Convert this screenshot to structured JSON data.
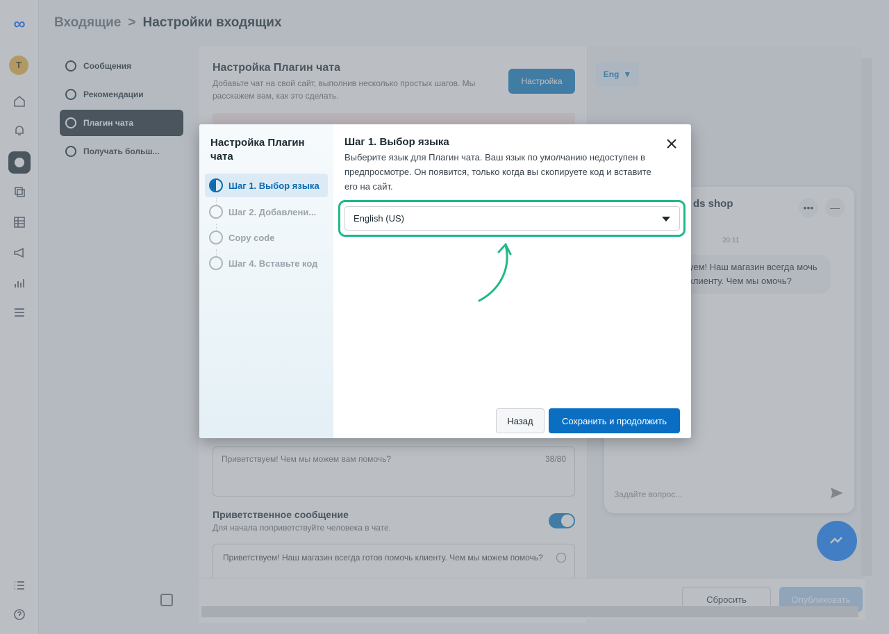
{
  "app": {
    "breadcrumb": {
      "parent": "Входящие",
      "separator": ">",
      "current": "Настройки входящих"
    },
    "avatar_letter": "T",
    "subnav": [
      {
        "label": "Сообщения"
      },
      {
        "label": "Рекомендации"
      },
      {
        "label": "Плагин чата"
      },
      {
        "label": "Получать больш..."
      }
    ]
  },
  "panel": {
    "title": "Настройка Плагин чата",
    "description": "Добавьте чат на свой сайт, выполнив несколько простых шагов. Мы расскажем вам, как это сделать.",
    "setup_button": "Настройка",
    "greeting_placeholder": "Приветствуем! Чем мы можем вам помочь?",
    "greeting_counter": "38/80",
    "welcome_title": "Приветственное сообщение",
    "welcome_desc": "Для начала поприветствуйте человека в чате.",
    "welcome_message": "Приветствуем! Наш магазин всегда готов помочь клиенту. Чем мы можем помочь?"
  },
  "preview": {
    "language_button": "Eng",
    "shop_name": "ds shop",
    "time": "20:11",
    "bubble_text": "уем! Наш магазин всегда мочь клиенту. Чем мы омочь?",
    "input_placeholder": "Задайте вопрос..."
  },
  "footer": {
    "reset_label": "Сбросить",
    "publish_label": "Опубликовать"
  },
  "modal": {
    "sidebar_title": "Настройка Плагин чата",
    "steps": [
      {
        "label": "Шаг 1. Выбор языка",
        "state": "active"
      },
      {
        "label": "Шаг 2. Добавлени...",
        "state": "pending"
      },
      {
        "label": "Copy code",
        "state": "pending"
      },
      {
        "label": "Шаг 4. Вставьте код",
        "state": "pending"
      }
    ],
    "step_title": "Шаг 1. Выбор языка",
    "step_description": "Выберите язык для Плагин чата. Ваш язык по умолчанию недоступен в предпросмотре. Он появится, только когда вы скопируете код и вставите его на сайт.",
    "language_select": {
      "value": "English (US)"
    },
    "back_label": "Назад",
    "save_label": "Сохранить и продолжить"
  },
  "colors": {
    "highlight": "#20b88a",
    "primary": "#0a6fc2",
    "sidebar_active": "#1c2b33"
  }
}
